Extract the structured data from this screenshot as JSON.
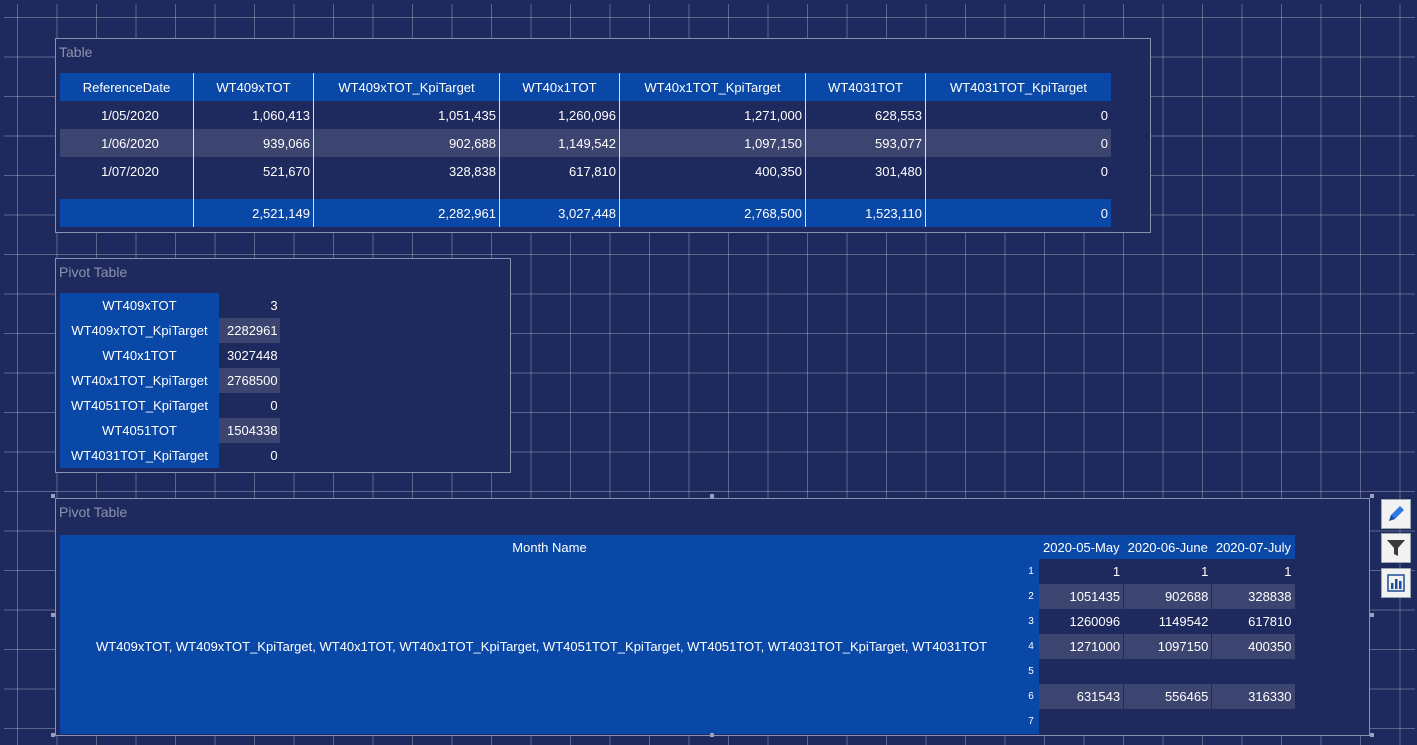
{
  "table1": {
    "title": "Table",
    "columns": [
      "ReferenceDate",
      "WT409xTOT",
      "WT409xTOT_KpiTarget",
      "WT40x1TOT",
      "WT40x1TOT_KpiTarget",
      "WT4031TOT",
      "WT4031TOT_KpiTarget"
    ],
    "rows": [
      [
        "1/05/2020",
        "1,060,413",
        "1,051,435",
        "1,260,096",
        "1,271,000",
        "628,553",
        "0"
      ],
      [
        "1/06/2020",
        "939,066",
        "902,688",
        "1,149,542",
        "1,097,150",
        "593,077",
        "0"
      ],
      [
        "1/07/2020",
        "521,670",
        "328,838",
        "617,810",
        "400,350",
        "301,480",
        "0"
      ]
    ],
    "totals": [
      "",
      "2,521,149",
      "2,282,961",
      "3,027,448",
      "2,768,500",
      "1,523,110",
      "0"
    ]
  },
  "pivot1": {
    "title": "Pivot Table",
    "rows": [
      {
        "key": "WT409xTOT",
        "value": "3"
      },
      {
        "key": "WT409xTOT_KpiTarget",
        "value": "2282961"
      },
      {
        "key": "WT40x1TOT",
        "value": "3027448"
      },
      {
        "key": "WT40x1TOT_KpiTarget",
        "value": "2768500"
      },
      {
        "key": "WT4051TOT_KpiTarget",
        "value": "0"
      },
      {
        "key": "WT4051TOT",
        "value": "1504338"
      },
      {
        "key": "WT4031TOT_KpiTarget",
        "value": "0"
      }
    ]
  },
  "pivot2": {
    "title": "Pivot Table",
    "row_header": "Month Name",
    "row_label": "WT409xTOT, WT409xTOT_KpiTarget, WT40x1TOT, WT40x1TOT_KpiTarget, WT4051TOT_KpiTarget, WT4051TOT, WT4031TOT_KpiTarget, WT4031TOT",
    "columns": [
      "2020-05-May",
      "2020-06-June",
      "2020-07-July"
    ],
    "rows": [
      {
        "idx": "1",
        "values": [
          "1",
          "1",
          "1"
        ]
      },
      {
        "idx": "2",
        "values": [
          "1051435",
          "902688",
          "328838"
        ]
      },
      {
        "idx": "3",
        "values": [
          "1260096",
          "1149542",
          "617810"
        ]
      },
      {
        "idx": "4",
        "values": [
          "1271000",
          "1097150",
          "400350"
        ]
      },
      {
        "idx": "5",
        "values": [
          "",
          "",
          ""
        ]
      },
      {
        "idx": "6",
        "values": [
          "631543",
          "556465",
          "316330"
        ]
      },
      {
        "idx": "7",
        "values": [
          "",
          "",
          ""
        ]
      }
    ]
  },
  "side_buttons": [
    {
      "icon": "pencil-icon"
    },
    {
      "icon": "filter-icon"
    },
    {
      "icon": "chart-icon"
    }
  ]
}
